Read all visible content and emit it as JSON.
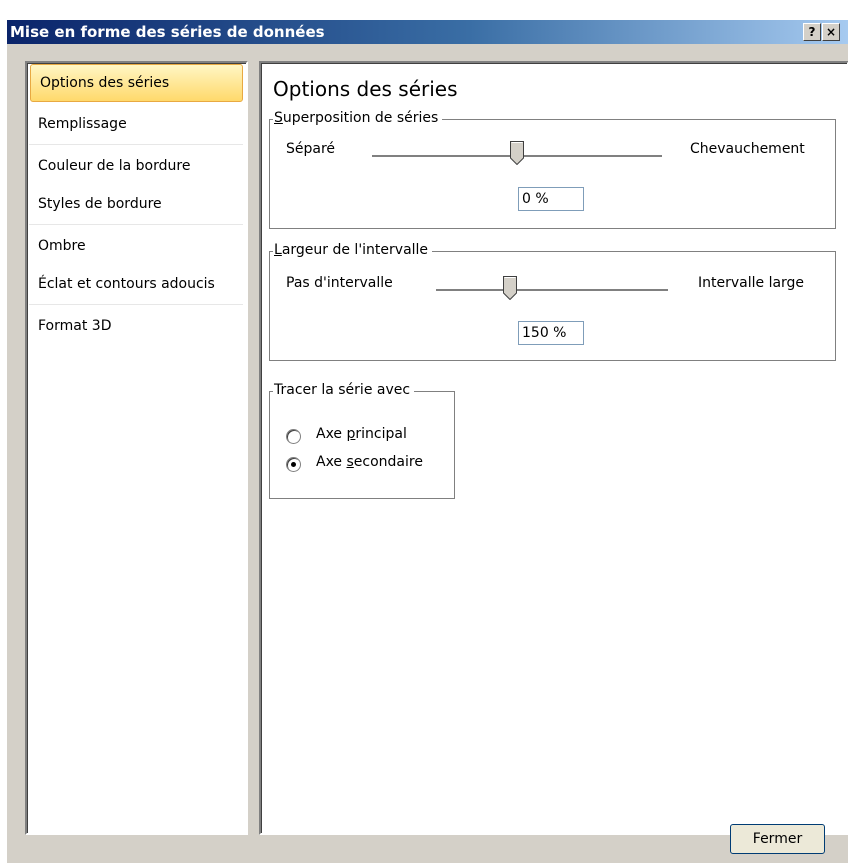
{
  "window": {
    "title": "Mise en forme des séries de données",
    "help_label": "?",
    "close_label": "×"
  },
  "sidebar": {
    "items": [
      {
        "label": "Options des séries",
        "selected": true
      },
      {
        "label": "Remplissage",
        "selected": false
      },
      {
        "label": "Couleur de la bordure",
        "selected": false
      },
      {
        "label": "Styles de bordure",
        "selected": false
      },
      {
        "label": "Ombre",
        "selected": false
      },
      {
        "label": "Éclat et contours adoucis",
        "selected": false
      },
      {
        "label": "Format 3D",
        "selected": false
      }
    ]
  },
  "main": {
    "title": "Options des séries",
    "overlap": {
      "legend_access": "S",
      "legend_rest": "uperposition de séries",
      "min_label": "Séparé",
      "max_label": "Chevauchement",
      "value": "0 %"
    },
    "gap": {
      "legend_access": "L",
      "legend_rest": "argeur de l'intervalle",
      "min_label": "Pas d'intervalle",
      "max_label": "Intervalle large",
      "value": "150 %"
    },
    "axis": {
      "legend": "Tracer la série avec",
      "primary_pre": "Axe ",
      "primary_access": "p",
      "primary_post": "rincipal",
      "secondary_pre": "Axe ",
      "secondary_access": "s",
      "secondary_post": "econdaire",
      "selected": "secondary"
    }
  },
  "footer": {
    "close_button": "Fermer"
  }
}
